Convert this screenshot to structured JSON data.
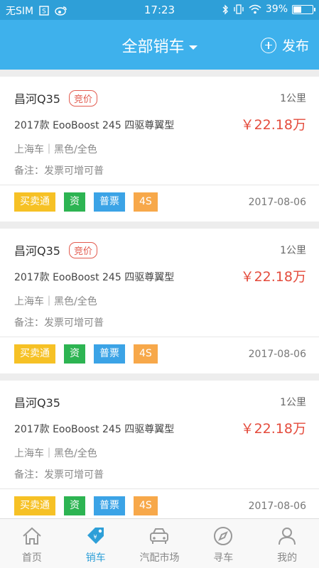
{
  "status_bar": {
    "carrier": "无SIM",
    "time": "17:23",
    "battery": "39%",
    "battery_level": 0.39
  },
  "header": {
    "title": "全部销车",
    "publish_label": "发布"
  },
  "listings": [
    {
      "model": "昌河Q35",
      "bid_badge": "竞价",
      "distance": "1公里",
      "config": "2017款 EooBoost 245 四驱尊翼型",
      "price": "￥22.18万",
      "origin": "上海车｜黑色/全色",
      "note": "备注：发票可增可普",
      "tags": [
        "买卖通",
        "资",
        "普票",
        "4S"
      ],
      "date": "2017-08-06"
    },
    {
      "model": "昌河Q35",
      "bid_badge": "竞价",
      "distance": "1公里",
      "config": "2017款 EooBoost 245 四驱尊翼型",
      "price": "￥22.18万",
      "origin": "上海车｜黑色/全色",
      "note": "备注：发票可增可普",
      "tags": [
        "买卖通",
        "资",
        "普票",
        "4S"
      ],
      "date": "2017-08-06"
    },
    {
      "model": "昌河Q35",
      "distance": "1公里",
      "config": "2017款 EooBoost 245 四驱尊翼型",
      "price": "￥22.18万",
      "origin": "上海车｜黑色/全色",
      "note": "备注：发票可增可普",
      "tags": [
        "买卖通",
        "资",
        "普票",
        "4S"
      ],
      "date": "2017-08-06"
    }
  ],
  "tabbar": {
    "items": [
      {
        "label": "首页",
        "icon": "home-icon"
      },
      {
        "label": "销车",
        "icon": "sell-tag-icon"
      },
      {
        "label": "汽配市场",
        "icon": "car-icon"
      },
      {
        "label": "寻车",
        "icon": "compass-icon"
      },
      {
        "label": "我的",
        "icon": "user-icon"
      }
    ],
    "active_index": 1
  },
  "colors": {
    "header_bg": "#3eb1ec",
    "status_bg": "#2e9fd8",
    "price": "#e44b3c",
    "tag_yellow": "#f6c125",
    "tag_green": "#2db452",
    "tag_blue": "#3ba3e6",
    "tag_orange": "#f7a84a"
  }
}
